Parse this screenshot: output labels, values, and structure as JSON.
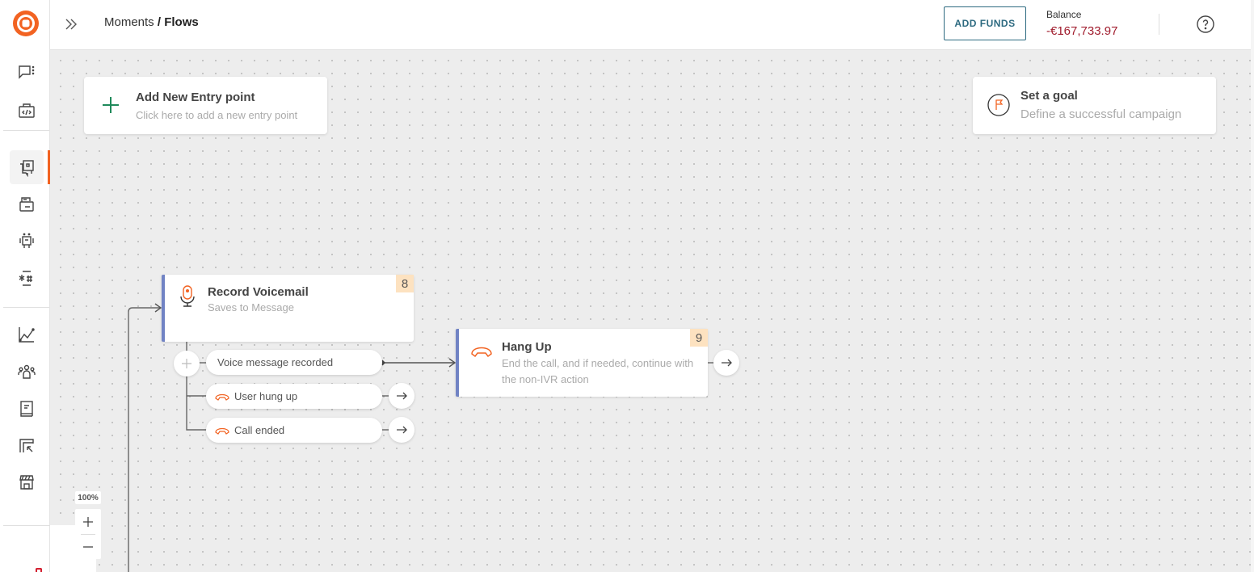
{
  "header": {
    "breadcrumb_parent": "Moments",
    "breadcrumb_sep": " / ",
    "breadcrumb_current": "Flows",
    "add_funds_label": "ADD FUNDS",
    "balance_label": "Balance",
    "balance_value": "-€167,733.97"
  },
  "sidebar": {
    "items": [
      {
        "name": "conversations",
        "icon": "chat-dots-icon"
      },
      {
        "name": "developer-tools",
        "icon": "code-briefcase-icon"
      },
      {
        "name": "moments",
        "icon": "copy-chat-icon",
        "active": true
      },
      {
        "name": "templates",
        "icon": "stacked-cards-icon"
      },
      {
        "name": "automation-bots",
        "icon": "robot-icon"
      },
      {
        "name": "numbers",
        "icon": "asterisk-hash-icon"
      },
      {
        "name": "analytics",
        "icon": "line-chart-icon"
      },
      {
        "name": "people",
        "icon": "people-group-icon"
      },
      {
        "name": "documentation",
        "icon": "book-icon"
      },
      {
        "name": "campaigns",
        "icon": "cursor-frame-icon"
      },
      {
        "name": "marketplace",
        "icon": "store-icon"
      }
    ]
  },
  "canvas": {
    "entry_card": {
      "title": "Add New Entry point",
      "subtitle": "Click here to add a new entry point"
    },
    "goal_card": {
      "title": "Set a goal",
      "subtitle": "Define a successful campaign"
    },
    "nodes": [
      {
        "index": "8",
        "title": "Record Voicemail",
        "subtitle": "Saves to Message"
      },
      {
        "index": "9",
        "title": "Hang Up",
        "subtitle": "End the call, and if needed, continue with the non-IVR action"
      }
    ],
    "branches": [
      {
        "label": "Voice message recorded"
      },
      {
        "label": "User hung up"
      },
      {
        "label": "Call ended"
      }
    ],
    "zoom_level": "100%",
    "zoom_in": "+",
    "zoom_out": "−"
  },
  "colors": {
    "brand": "#f26322",
    "node_accent": "#7183c4",
    "index_badge": "#fde2c0",
    "balance_negative": "#a01c2d",
    "add_funds": "#2d6a80",
    "entry_plus": "#1f8a5b"
  }
}
